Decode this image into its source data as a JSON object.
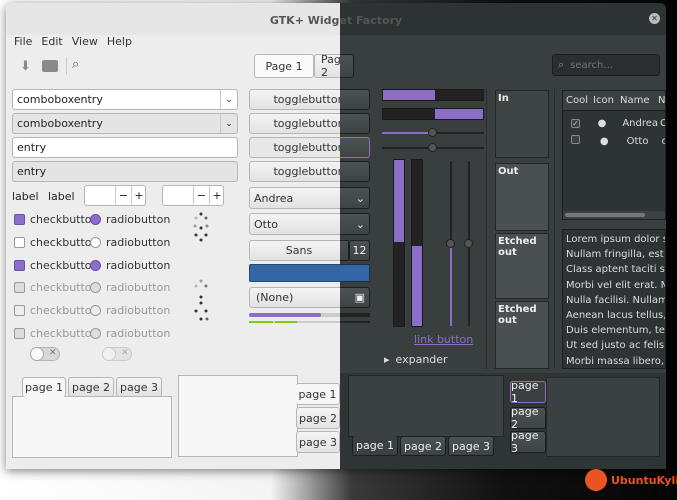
{
  "title": "GTK+ Widget Factory",
  "menu": {
    "file": "File",
    "edit": "Edit",
    "view": "View",
    "help": "Help"
  },
  "pages": {
    "page1": "Page 1",
    "page2": "Page 2"
  },
  "search": {
    "placeholder": "search..."
  },
  "left": {
    "combo1": "comboboxentry",
    "combo2": "comboboxentry",
    "entry1": "entry",
    "entry2": "entry",
    "label1": "label",
    "label2": "label",
    "checkbutton": "checkbutton",
    "radiobutton": "radiobutton"
  },
  "mid": {
    "toggle": "togglebutton",
    "combo_andrea": "Andrea",
    "combo_otto": "Otto",
    "font_name": "Sans",
    "font_size": "12",
    "file_none": "(None)"
  },
  "right": {
    "link": "link button",
    "expander": "expander",
    "frame_in": "In",
    "frame_out": "Out",
    "frame_etched_in": "Etched out",
    "frame_etched_out": "Etched out"
  },
  "tree": {
    "headers": [
      "Cool",
      "Icon",
      "Name",
      "N"
    ],
    "rows": [
      {
        "name": "Andrea",
        "extra": "C",
        "checked": true,
        "icon": "check-circle"
      },
      {
        "name": "Otto",
        "extra": "c",
        "checked": false,
        "icon": "alert-circle"
      }
    ]
  },
  "text_lines": [
    "Lorem ipsum dolor sit",
    "Nullam fringilla, est u",
    "Class aptent taciti so",
    "Morbi vel elit erat. M",
    "Nulla facilisi. Nullam",
    "Aenean lacus tellus,",
    "Duis elementum, tell",
    "Ut sed justo ac felis p",
    "Morbi massa libero, c"
  ],
  "tabs": {
    "page1": "page 1",
    "page2": "page 2",
    "page3": "page 3"
  },
  "logo": "UbuntuKylin",
  "colors": {
    "accent": "#8c6ec8",
    "blue": "#3465a4",
    "green": "#73d216",
    "orange": "#e95420"
  }
}
